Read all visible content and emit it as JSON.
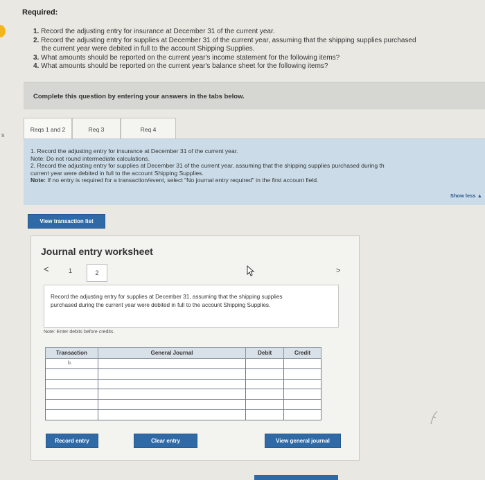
{
  "required": {
    "title": "Required:",
    "items": [
      {
        "num": "1.",
        "text": "Record the adjusting entry for insurance at December 31 of the current year."
      },
      {
        "num": "2.",
        "text": "Record the adjusting entry for supplies at December 31 of the current year, assuming that the shipping supplies purchased"
      },
      {
        "num": "",
        "text": "the current year were debited in full to the account Shipping Supplies."
      },
      {
        "num": "3.",
        "text": "What amounts should be reported on the current year's income statement for the following items?"
      },
      {
        "num": "4.",
        "text": "What amounts should be reported on the current year's balance sheet for the following items?"
      }
    ]
  },
  "instruction": "Complete this question by entering your answers in the tabs below.",
  "tabs": [
    {
      "label": "Reqs 1 and 2"
    },
    {
      "label": "Req 3"
    },
    {
      "label": "Req 4"
    }
  ],
  "req_panel": {
    "line1": "1. Record the adjusting entry for insurance at December 31 of the current year.",
    "line2": "Note: Do not round intermediate calculations.",
    "line3": "2. Record the adjusting entry for supplies at December 31 of the current year, assuming that the shipping supplies purchased during th",
    "line4": "current year were debited in full to the account Shipping Supplies.",
    "line5_label": "Note:",
    "line5": "If no entry is required for a transaction/event, select \"No journal entry required\" in the first account field.",
    "show_less": "Show less ▲"
  },
  "view_transaction_list": "View transaction list",
  "worksheet": {
    "title": "Journal entry worksheet",
    "prev": "<",
    "page1": "1",
    "page2": "2",
    "next": ">",
    "description": "Record the adjusting entry for supplies at December 31, assuming that the shipping supplies purchased during the current year were debited in full to the account Shipping Supplies.",
    "note": "Note: Enter debits before credits.",
    "columns": [
      "Transaction",
      "General Journal",
      "Debit",
      "Credit"
    ],
    "rows": [
      {
        "transaction": "b.",
        "account": "",
        "debit": "",
        "credit": ""
      },
      {
        "transaction": "",
        "account": "",
        "debit": "",
        "credit": ""
      },
      {
        "transaction": "",
        "account": "",
        "debit": "",
        "credit": ""
      },
      {
        "transaction": "",
        "account": "",
        "debit": "",
        "credit": ""
      },
      {
        "transaction": "",
        "account": "",
        "debit": "",
        "credit": ""
      },
      {
        "transaction": "",
        "account": "",
        "debit": "",
        "credit": ""
      }
    ],
    "record_entry": "Record entry",
    "clear_entry": "Clear entry",
    "view_general_journal": "View general journal"
  },
  "margin_mark": "s",
  "colors": {
    "accent_blue": "#2f6aa6",
    "panel_blue": "#cbdce8",
    "indicator_yellow": "#f2b51c"
  }
}
